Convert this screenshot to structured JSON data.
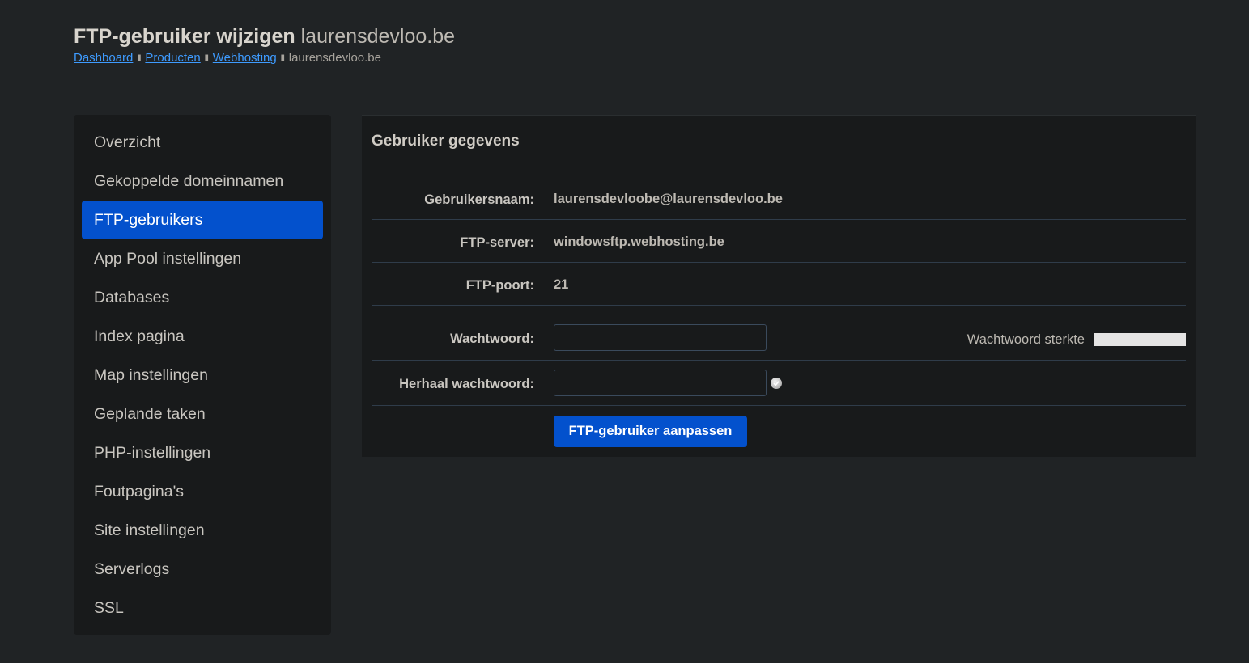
{
  "header": {
    "title": "FTP-gebruiker wijzigen",
    "domain": "laurensdevloo.be"
  },
  "breadcrumb": {
    "items": [
      "Dashboard",
      "Producten",
      "Webhosting"
    ],
    "current": "laurensdevloo.be",
    "separator": "▮"
  },
  "sidebar": {
    "items": [
      {
        "label": "Overzicht"
      },
      {
        "label": "Gekoppelde domeinnamen"
      },
      {
        "label": "FTP-gebruikers",
        "active": true
      },
      {
        "label": "App Pool instellingen"
      },
      {
        "label": "Databases"
      },
      {
        "label": "Index pagina"
      },
      {
        "label": "Map instellingen"
      },
      {
        "label": "Geplande taken"
      },
      {
        "label": "PHP-instellingen"
      },
      {
        "label": "Foutpagina's"
      },
      {
        "label": "Site instellingen"
      },
      {
        "label": "Serverlogs"
      },
      {
        "label": "SSL"
      }
    ]
  },
  "panel": {
    "heading": "Gebruiker gegevens",
    "username_label": "Gebruikersnaam:",
    "username_value": "laurensdevloobe@laurensdevloo.be",
    "server_label": "FTP-server:",
    "server_value": "windowsftp.webhosting.be",
    "port_label": "FTP-poort:",
    "port_value": "21",
    "password_label": "Wachtwoord:",
    "password_value": "",
    "password_strength_label": "Wachtwoord sterkte",
    "repeat_label": "Herhaal wachtwoord:",
    "repeat_value": "",
    "submit_label": "FTP-gebruiker aanpassen"
  },
  "colors": {
    "background": "#202325",
    "panel": "#181a1b",
    "accent": "#0351cd",
    "link": "#3e9bff"
  }
}
